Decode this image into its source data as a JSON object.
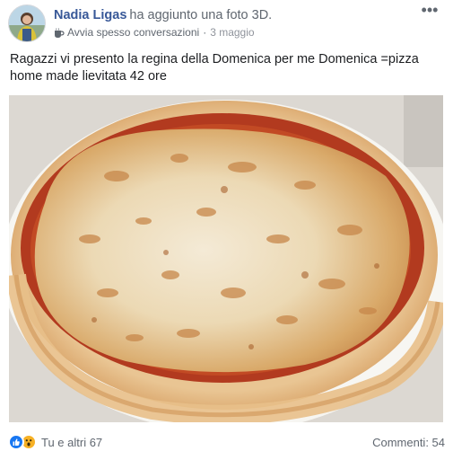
{
  "post": {
    "author": "Nadia Ligas",
    "action": "ha aggiunto una foto 3D.",
    "badge": "Avvia spesso conversazioni",
    "separator": "·",
    "date": "3 maggio",
    "more": "•••",
    "caption": "Ragazzi vi presento la regina della Domenica per me Domenica =pizza home made lievitata 42 ore"
  },
  "photo": {
    "subject": "pizza-photo"
  },
  "footer": {
    "reaction_icons": [
      "like-icon",
      "wow-icon"
    ],
    "reactions_text": "Tu e altri 67",
    "comments_text": "Commenti: 54"
  },
  "colors": {
    "author": "#385898",
    "text": "#1c1e21",
    "muted": "#606770",
    "like": "#1877f2",
    "wow": "#f7b125"
  }
}
